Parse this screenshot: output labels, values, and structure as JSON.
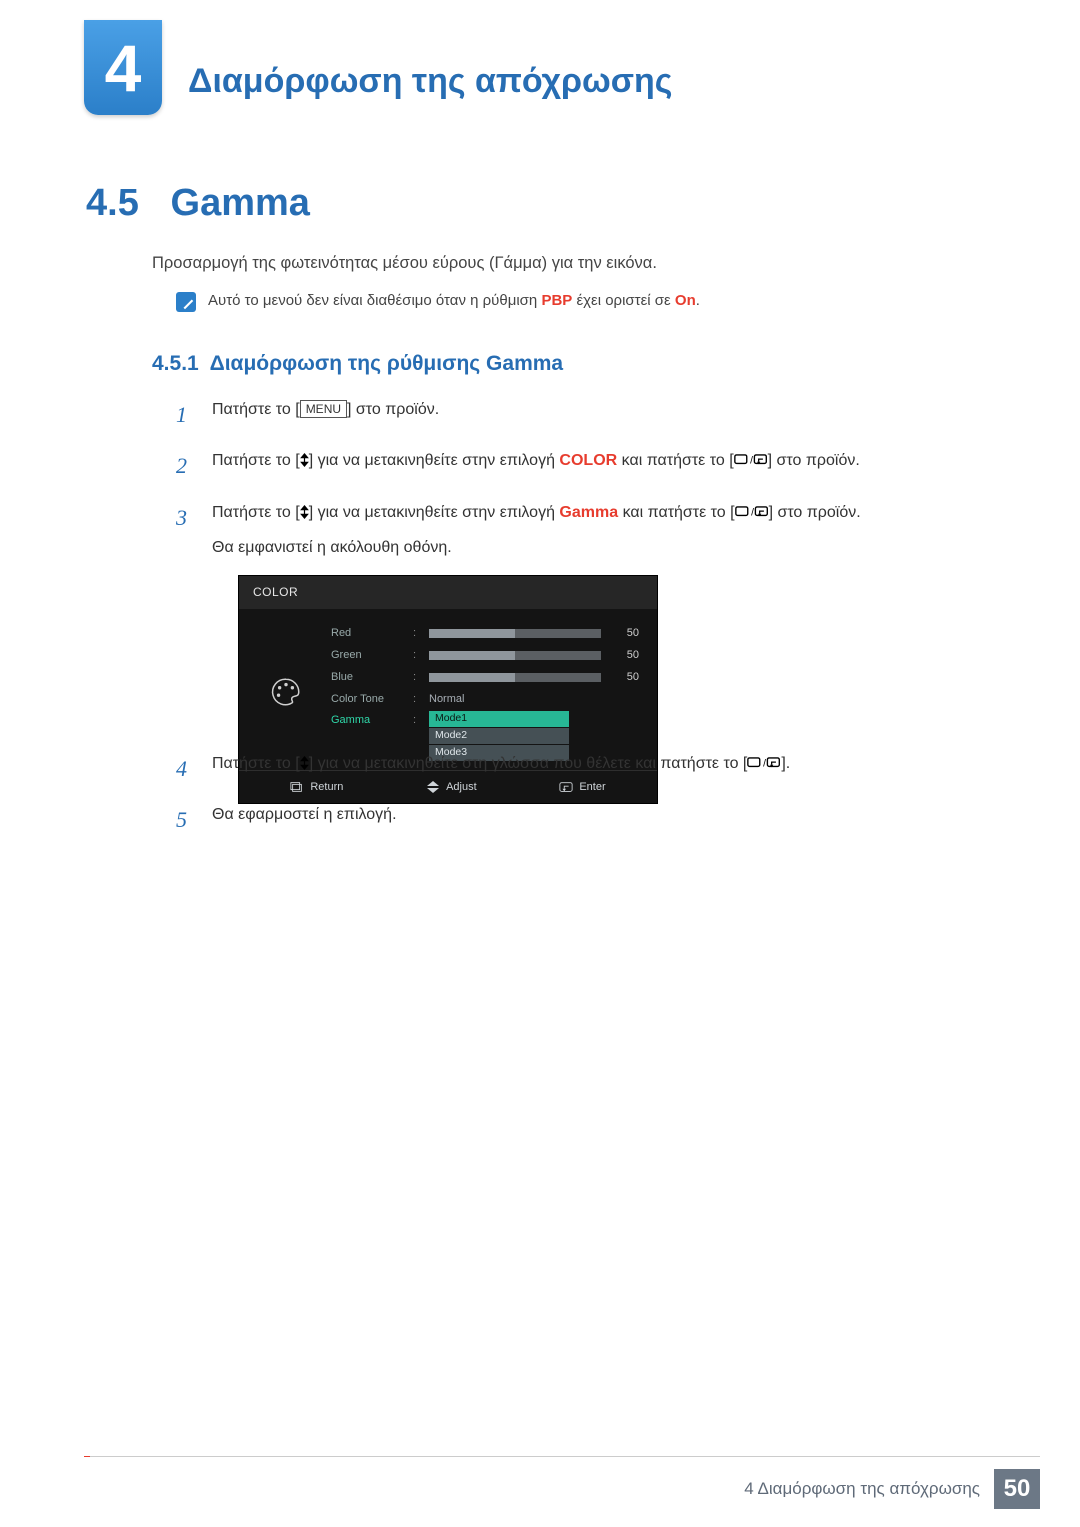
{
  "chapter": {
    "number": "4",
    "title": "Διαμόρφωση της απόχρωσης"
  },
  "section": {
    "number": "4.5",
    "title": "Gamma"
  },
  "intro": "Προσαρμογή της φωτεινότητας μέσου εύρους (Γάμμα) για την εικόνα.",
  "note": {
    "pre": "Αυτό το μενού δεν είναι διαθέσιμο όταν η ρύθμιση ",
    "pbp": "PBP",
    "mid": " έχει οριστεί σε ",
    "on": "On",
    "post": "."
  },
  "subsection": {
    "number": "4.5.1",
    "title": "Διαμόρφωση της ρύθμισης Gamma"
  },
  "buttons": {
    "menu": "MENU"
  },
  "steps": {
    "s1": {
      "num": "1",
      "a": "Πατήστε το [",
      "b": "] στο προϊόν."
    },
    "s2": {
      "num": "2",
      "a": "Πατήστε το [",
      "b": "] για να μετακινηθείτε στην επιλογή ",
      "kw": "COLOR",
      "c": " και πατήστε το [",
      "d": "] στο προϊόν."
    },
    "s3": {
      "num": "3",
      "a": "Πατήστε το [",
      "b": "] για να μετακινηθείτε στην επιλογή ",
      "kw": "Gamma",
      "c": " και πατήστε το [",
      "d": "] στο προϊόν.",
      "e": "Θα εμφανιστεί η ακόλουθη οθόνη."
    },
    "s4": {
      "num": "4",
      "a": "Πατήστε το [",
      "b": "] για να μετακινηθείτε στη γλώσσα που θέλετε και πατήστε το [",
      "c": "]."
    },
    "s5": {
      "num": "5",
      "a": "Θα εφαρμοστεί η επιλογή."
    }
  },
  "osd": {
    "title": "COLOR",
    "rows": {
      "red": {
        "label": "Red",
        "value": "50"
      },
      "green": {
        "label": "Green",
        "value": "50"
      },
      "blue": {
        "label": "Blue",
        "value": "50"
      },
      "colortone": {
        "label": "Color Tone",
        "value": "Normal"
      },
      "gamma": {
        "label": "Gamma",
        "modes": [
          "Mode1",
          "Mode2",
          "Mode3"
        ],
        "selected": "Mode1"
      }
    },
    "footer": {
      "return": "Return",
      "adjust": "Adjust",
      "enter": "Enter"
    }
  },
  "footer": {
    "text": "4 Διαμόρφωση της απόχρωσης",
    "page": "50"
  }
}
